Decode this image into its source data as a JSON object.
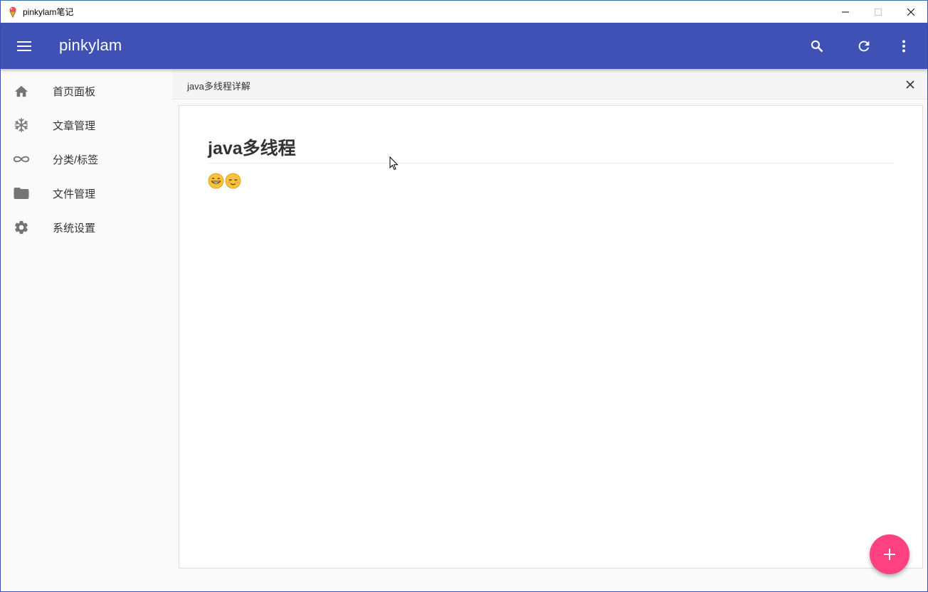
{
  "window": {
    "title": "pinkylam笔记",
    "icon": "ice-cream-icon"
  },
  "appbar": {
    "title": "pinkylam",
    "color": "#3f51b5",
    "actions": [
      "search-icon",
      "refresh-icon",
      "more-vert-icon"
    ]
  },
  "sidebar": {
    "items": [
      {
        "label": "首页面板",
        "icon": "home-icon"
      },
      {
        "label": "文章管理",
        "icon": "snowflake-icon"
      },
      {
        "label": "分类/标签",
        "icon": "infinity-icon"
      },
      {
        "label": "文件管理",
        "icon": "folder-icon"
      },
      {
        "label": "系统设置",
        "icon": "gear-icon"
      }
    ]
  },
  "tab": {
    "title": "java多线程详解"
  },
  "document": {
    "heading": "java多线程",
    "emojis": [
      "grinning-face",
      "smiling-face"
    ]
  },
  "fab": {
    "icon": "plus-icon",
    "color": "#ff4081"
  }
}
